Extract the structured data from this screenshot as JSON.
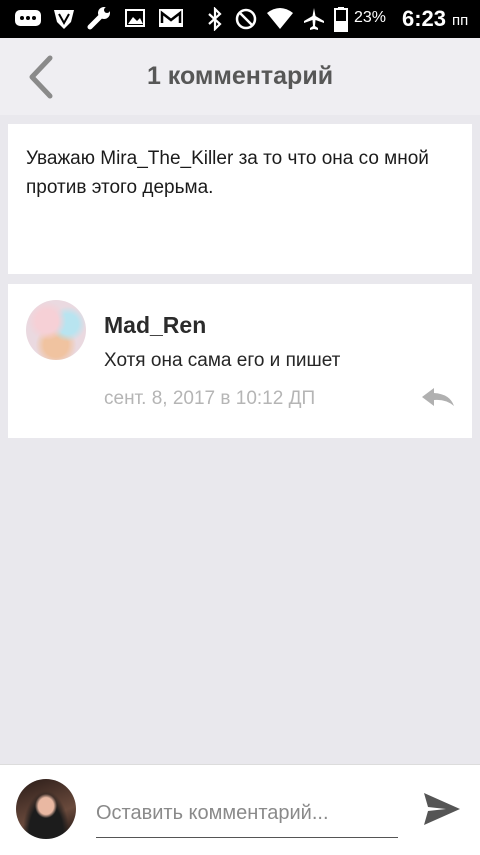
{
  "status_bar": {
    "battery_percent": "23%",
    "time": "6:23",
    "ampm": "пп",
    "icons": [
      "messages-icon",
      "shield-icon",
      "wrench-icon",
      "image-icon",
      "mail-icon",
      "bluetooth-icon",
      "do-not-disturb-icon",
      "wifi-icon",
      "airplane-icon",
      "battery-icon"
    ]
  },
  "header": {
    "title": "1 комментарий",
    "back_icon": "chevron-left-icon"
  },
  "post": {
    "text": "Уважаю Mira_The_Killer за то что она со мной против этого дерьма."
  },
  "comments": [
    {
      "author": "Mad_Ren",
      "text": "Хотя она сама его и пишет",
      "date": "сент. 8, 2017 в 10:12 ДП",
      "reply_icon": "reply-icon"
    }
  ],
  "composer": {
    "placeholder": "Оставить комментарий...",
    "send_icon": "send-icon"
  },
  "colors": {
    "background": "#e9e8ed",
    "header_bg": "#efeef2",
    "card_bg": "#ffffff",
    "muted_text": "#b5b5b5"
  }
}
